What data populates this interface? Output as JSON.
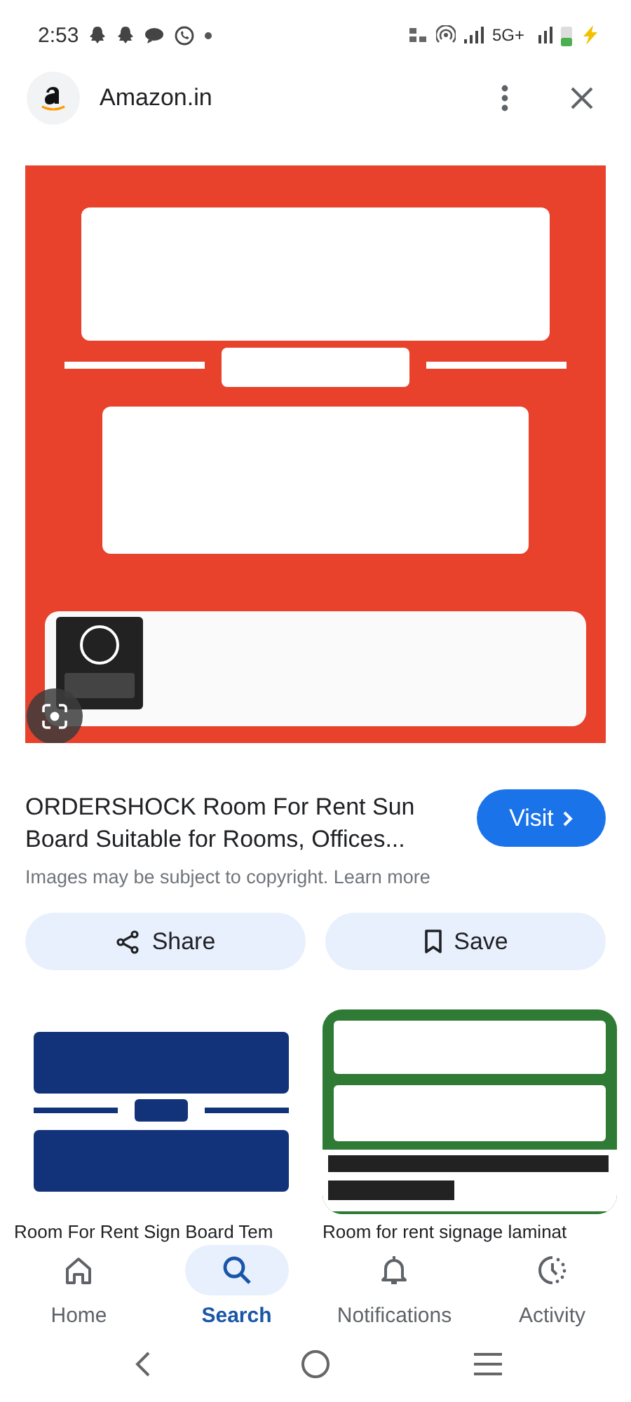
{
  "status_bar": {
    "time": "2:53",
    "network": "5G+"
  },
  "header": {
    "site": "Amazon.in"
  },
  "result": {
    "title": "ORDERSHOCK Room For Rent Sun Board Suitable for Rooms, Offices...",
    "visit": "Visit",
    "notice": "Images may be subject to copyright.",
    "learn_more": "Learn more",
    "actions": [
      {
        "kind": "share",
        "label": "Share"
      },
      {
        "kind": "save",
        "label": "Save"
      }
    ]
  },
  "related": [
    {
      "kind": "picture",
      "caption": "Room For Rent Sign Board Tem"
    },
    {
      "kind": "picture",
      "caption": "Room for rent signage laminat"
    }
  ],
  "nav": [
    {
      "kind": "home",
      "label": "Home",
      "selected": false
    },
    {
      "kind": "search",
      "label": "Search",
      "selected": true
    },
    {
      "kind": "notifications",
      "label": "Notifications",
      "selected": false
    },
    {
      "kind": "activity",
      "label": "Activity",
      "selected": false
    }
  ]
}
